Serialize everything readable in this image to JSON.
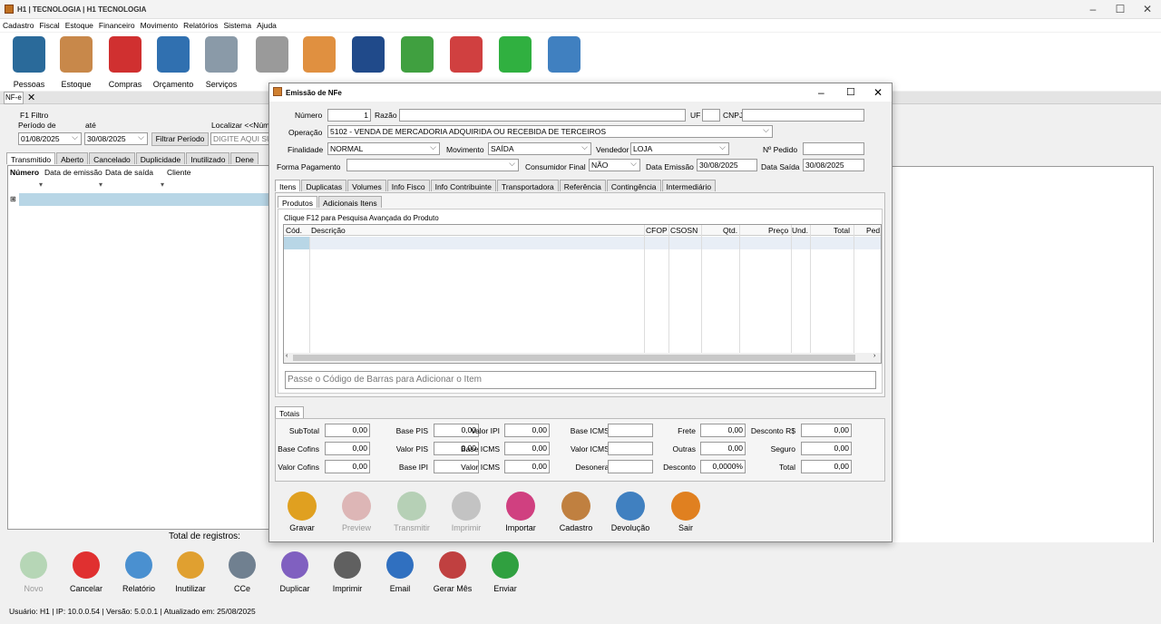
{
  "window": {
    "title": "H1 | TECNOLOGIA | H1 TECNOLOGIA"
  },
  "menu": [
    "Cadastro",
    "Fiscal",
    "Estoque",
    "Financeiro",
    "Movimento",
    "Relatórios",
    "Sistema",
    "Ajuda"
  ],
  "toolbar": [
    {
      "label": "Pessoas",
      "icon": "person-icon",
      "color": "#2a6a9a"
    },
    {
      "label": "Estoque",
      "icon": "box-icon",
      "color": "#c8884a"
    },
    {
      "label": "Compras",
      "icon": "basket-icon",
      "color": "#d03030"
    },
    {
      "label": "Orçamento",
      "icon": "calculator-icon",
      "color": "#3070b0"
    },
    {
      "label": "Serviços",
      "icon": "wrench-icon",
      "color": "#8a9aa8"
    },
    {
      "label": "",
      "icon": "register-icon",
      "color": "#9a9a9a"
    },
    {
      "label": "",
      "icon": "nfe-icon",
      "color": "#e09040"
    },
    {
      "label": "",
      "icon": "money-book-icon",
      "color": "#204a8a"
    },
    {
      "label": "",
      "icon": "cash-icon",
      "color": "#40a040"
    },
    {
      "label": "",
      "icon": "cash-out-icon",
      "color": "#d04040"
    },
    {
      "label": "",
      "icon": "whatsapp-icon",
      "color": "#30b040"
    },
    {
      "label": "",
      "icon": "usb-icon",
      "color": "#4080c0"
    }
  ],
  "doc_tab": {
    "label": "NF-e"
  },
  "filter": {
    "title": "F1 Filtro",
    "period_label": "Período de",
    "until_label": "até",
    "date_from": "01/08/2025",
    "date_to": "30/08/2025",
    "filter_button": "Filtrar Período",
    "search_label": "Localizar <<Núm",
    "search_placeholder": "DIGITE AQUI SU"
  },
  "status_tabs": [
    "Transmitido",
    "Aberto",
    "Cancelado",
    "Duplicidade",
    "Inutilizado",
    "Dene"
  ],
  "grid": {
    "columns": [
      "Número",
      "Data de emissão",
      "Data de saída",
      "Cliente"
    ],
    "total_label": "Total de registros:"
  },
  "bottom_buttons": [
    {
      "label": "Novo",
      "icon": "add-icon",
      "color": "#60b060",
      "disabled": true
    },
    {
      "label": "Cancelar",
      "icon": "cancel-icon",
      "color": "#e03030",
      "disabled": false
    },
    {
      "label": "Relatório",
      "icon": "report-icon",
      "color": "#4a90d0",
      "disabled": false
    },
    {
      "label": "Inutilizar",
      "icon": "void-icon",
      "color": "#e0a030",
      "disabled": false
    },
    {
      "label": "CCe",
      "icon": "cce-icon",
      "color": "#708090",
      "disabled": false
    },
    {
      "label": "Duplicar",
      "icon": "duplicate-icon",
      "color": "#8060c0",
      "disabled": false
    },
    {
      "label": "Imprimir",
      "icon": "printer-icon",
      "color": "#606060",
      "disabled": false
    },
    {
      "label": "Email",
      "icon": "email-icon",
      "color": "#3070c0",
      "disabled": false
    },
    {
      "label": "Gerar Mês",
      "icon": "calendar-icon",
      "color": "#c04040",
      "disabled": false
    },
    {
      "label": "Enviar",
      "icon": "whatsapp-icon",
      "color": "#30a040",
      "disabled": false
    }
  ],
  "status_bar": "Usuário: H1 | IP: 10.0.0.54 | Versão: 5.0.0.1 | Atualizado em: 25/08/2025",
  "dialog": {
    "title": "Emissão de NFe",
    "numero_label": "Número",
    "numero_value": "1",
    "razao_label": "Razão",
    "uf_label": "UF",
    "cnpj_label": "CNPJ",
    "operacao_label": "Operação",
    "operacao_value": "5102 - VENDA DE MERCADORIA ADQUIRIDA OU RECEBIDA DE TERCEIROS",
    "finalidade_label": "Finalidade",
    "finalidade_value": "NORMAL",
    "movimento_label": "Movimento",
    "movimento_value": "SAÍDA",
    "vendedor_label": "Vendedor",
    "vendedor_value": "LOJA",
    "pedido_label": "Nº Pedido",
    "pagamento_label": "Forma Pagamento",
    "consumidor_label": "Consumidor Final",
    "consumidor_value": "NÃO",
    "emissao_label": "Data Emissão",
    "emissao_value": "30/08/2025",
    "saida_label": "Data Saída",
    "saida_value": "30/08/2025",
    "tabs": [
      "Itens",
      "Duplicatas",
      "Volumes",
      "Info Fisco",
      "Info Contribuinte",
      "Transportadora",
      "Referência",
      "Contingência",
      "Intermediário"
    ],
    "subtabs": [
      "Produtos",
      "Adicionais Itens"
    ],
    "hint": "Clique F12 para Pesquisa Avançada do Produto",
    "item_columns": [
      "Cód.",
      "Descrição",
      "CFOP",
      "CSOSN",
      "Qtd.",
      "Preço",
      "Und.",
      "Total",
      "Ped"
    ],
    "barcode_placeholder": "Passe o Código de Barras  para Adicionar o Item",
    "totals_tab": "Totais",
    "totals": [
      [
        {
          "l": "SubTotal",
          "v": "0,00"
        },
        {
          "l": "Base PIS",
          "v": "0,00"
        },
        {
          "l": "Valor IPI",
          "v": "0,00"
        },
        {
          "l": "Base ICMS ST",
          "v": ""
        },
        {
          "l": "Frete",
          "v": "0,00"
        },
        {
          "l": "Desconto R$",
          "v": "0,00"
        }
      ],
      [
        {
          "l": "Base Cofins",
          "v": "0,00"
        },
        {
          "l": "Valor PIS",
          "v": "0,00"
        },
        {
          "l": "Base ICMS",
          "v": "0,00"
        },
        {
          "l": "Valor ICMS ST",
          "v": ""
        },
        {
          "l": "Outras",
          "v": "0,00"
        },
        {
          "l": "Seguro",
          "v": "0,00"
        }
      ],
      [
        {
          "l": "Valor Cofins",
          "v": "0,00"
        },
        {
          "l": "Base IPI",
          "v": ""
        },
        {
          "l": "Valor ICMS",
          "v": "0,00"
        },
        {
          "l": "Desoneração",
          "v": ""
        },
        {
          "l": "Desconto",
          "v": "0,0000%"
        },
        {
          "l": "Total",
          "v": "0,00"
        }
      ]
    ],
    "actions": [
      {
        "label": "Gravar",
        "icon": "save-icon",
        "color": "#e0a020",
        "disabled": false
      },
      {
        "label": "Preview",
        "icon": "preview-icon",
        "color": "#c06060",
        "disabled": true
      },
      {
        "label": "Transmitir",
        "icon": "transmit-icon",
        "color": "#60a060",
        "disabled": true
      },
      {
        "label": "Imprimir",
        "icon": "printer-icon",
        "color": "#808080",
        "disabled": true
      },
      {
        "label": "Importar",
        "icon": "import-icon",
        "color": "#d04080",
        "disabled": false
      },
      {
        "label": "Cadastro",
        "icon": "register-icon",
        "color": "#c08040",
        "disabled": false
      },
      {
        "label": "Devolução",
        "icon": "return-icon",
        "color": "#4080c0",
        "disabled": false
      },
      {
        "label": "Sair",
        "icon": "exit-icon",
        "color": "#e08020",
        "disabled": false
      }
    ]
  }
}
